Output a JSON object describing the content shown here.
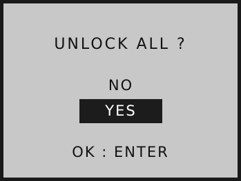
{
  "dialog": {
    "title": "UNLOCK ALL ?",
    "options": [
      {
        "label": "NO",
        "selected": false
      },
      {
        "label": "YES",
        "selected": true
      }
    ],
    "hint": "OK : ENTER"
  },
  "colors": {
    "background": "#c8c8c8",
    "frame": "#1a1a1a",
    "text": "#111111",
    "highlight_bg": "#1c1c1c",
    "highlight_text": "#ffffff"
  }
}
